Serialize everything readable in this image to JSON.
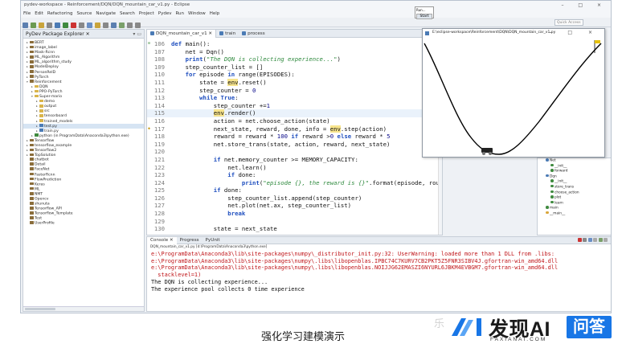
{
  "window": {
    "title": "pydev-workspace - Reinforcement/DQN/DQN_mountain_car_v1.py - Eclipse",
    "controls": "– □ ×",
    "menu": [
      "File",
      "Edit",
      "Refactoring",
      "Source",
      "Navigate",
      "Search",
      "Project",
      "Pydev",
      "Run",
      "Window",
      "Help"
    ],
    "quick_access_placeholder": "Quick Access"
  },
  "start_popup": {
    "label": "Run...",
    "button": "Start"
  },
  "explorer": {
    "title": "PyDev Package Explorer ✕",
    "items": [
      {
        "label": "BERT",
        "indent": 0,
        "arrow": ">",
        "icon": "#8a6d3b"
      },
      {
        "label": "image_label",
        "indent": 0,
        "arrow": ">",
        "icon": "#8a6d3b"
      },
      {
        "label": "Mask-Rcnn",
        "indent": 0,
        "arrow": ">",
        "icon": "#8a6d3b"
      },
      {
        "label": "ML_Algorithm",
        "indent": 0,
        "arrow": ">",
        "icon": "#8a6d3b"
      },
      {
        "label": "ML_algorithm_study",
        "indent": 0,
        "arrow": ">",
        "icon": "#8a6d3b"
      },
      {
        "label": "ModelDeploy",
        "indent": 0,
        "arrow": ">",
        "icon": "#8a6d3b"
      },
      {
        "label": "PersonReID",
        "indent": 0,
        "arrow": ">",
        "icon": "#8a6d3b"
      },
      {
        "label": "PyTorch",
        "indent": 0,
        "arrow": ">",
        "icon": "#8a6d3b"
      },
      {
        "label": "Reinforcement",
        "indent": 0,
        "arrow": "v",
        "icon": "#8a6d3b"
      },
      {
        "label": "DQN",
        "indent": 1,
        "arrow": ">",
        "icon": "#d9b44a"
      },
      {
        "label": "PPO-PyTorch",
        "indent": 1,
        "arrow": ">",
        "icon": "#d9b44a"
      },
      {
        "label": "Super-mario",
        "indent": 1,
        "arrow": "v",
        "icon": "#d9b44a"
      },
      {
        "label": "demo",
        "indent": 2,
        "arrow": ">",
        "icon": "#d9b44a"
      },
      {
        "label": "output",
        "indent": 2,
        "arrow": ">",
        "icon": "#d9b44a"
      },
      {
        "label": "src",
        "indent": 2,
        "arrow": ">",
        "icon": "#d9b44a"
      },
      {
        "label": "tensorboard",
        "indent": 2,
        "arrow": ">",
        "icon": "#d9b44a"
      },
      {
        "label": "trained_models",
        "indent": 2,
        "arrow": ">",
        "icon": "#d9b44a"
      },
      {
        "label": "test.py",
        "indent": 2,
        "arrow": ">",
        "icon": "#4b7bb5",
        "selected": true
      },
      {
        "label": "train.py",
        "indent": 2,
        "arrow": ">",
        "icon": "#4b7bb5"
      },
      {
        "label": "python (in ProgramData\\Anaconda3\\python.exe)",
        "indent": 1,
        "arrow": ">",
        "icon": "#3f8a3f"
      },
      {
        "label": "Tensorflow",
        "indent": 0,
        "arrow": ">",
        "icon": "#8a6d3b"
      },
      {
        "label": "tensorflow_example",
        "indent": 0,
        "arrow": ">",
        "icon": "#8a6d3b"
      },
      {
        "label": "Tensorflow2",
        "indent": 0,
        "arrow": ">",
        "icon": "#8a6d3b"
      },
      {
        "label": "TopSolution",
        "indent": 0,
        "arrow": ">",
        "icon": "#8a6d3b"
      },
      {
        "label": "chatbot",
        "indent": 0,
        "arrow": "",
        "icon": "#8a6d3b"
      },
      {
        "label": "Detail",
        "indent": 0,
        "arrow": "",
        "icon": "#8a6d3b"
      },
      {
        "label": "FaceNet",
        "indent": 0,
        "arrow": "",
        "icon": "#8a6d3b"
      },
      {
        "label": "FasterRcnn",
        "indent": 0,
        "arrow": "",
        "icon": "#8a6d3b"
      },
      {
        "label": "FlowPrediction",
        "indent": 0,
        "arrow": "",
        "icon": "#8a6d3b"
      },
      {
        "label": "Keras",
        "indent": 0,
        "arrow": "",
        "icon": "#8a6d3b"
      },
      {
        "label": "ML",
        "indent": 0,
        "arrow": "",
        "icon": "#8a6d3b"
      },
      {
        "label": "NMT",
        "indent": 0,
        "arrow": "",
        "icon": "#8a6d3b"
      },
      {
        "label": "Opencv",
        "indent": 0,
        "arrow": "",
        "icon": "#8a6d3b"
      },
      {
        "label": "shunuta",
        "indent": 0,
        "arrow": "",
        "icon": "#8a6d3b"
      },
      {
        "label": "Tensorflow_API",
        "indent": 0,
        "arrow": "",
        "icon": "#8a6d3b"
      },
      {
        "label": "Tensorflow_Template",
        "indent": 0,
        "arrow": "",
        "icon": "#8a6d3b"
      },
      {
        "label": "Test",
        "indent": 0,
        "arrow": "",
        "icon": "#8a6d3b"
      },
      {
        "label": "UserProfile",
        "indent": 0,
        "arrow": "",
        "icon": "#8a6d3b"
      }
    ]
  },
  "editor": {
    "tabs": [
      {
        "label": "DQN_mountain_car_v1 ✕",
        "active": true
      },
      {
        "label": "train",
        "active": false
      },
      {
        "label": "process",
        "active": false
      }
    ],
    "lines": [
      {
        "n": "106",
        "marker": "⊖",
        "html": "<span class='kw'>def</span> main():"
      },
      {
        "n": "107",
        "marker": "",
        "html": "    net = Dqn()"
      },
      {
        "n": "108",
        "marker": "",
        "html": "    <span class='kw'>print</span>(<span class='str'>\"The DQN is collecting experience...\"</span>)"
      },
      {
        "n": "109",
        "marker": "",
        "html": "    step_counter_list = []"
      },
      {
        "n": "110",
        "marker": "",
        "html": "    <span class='kw'>for</span> episode <span class='kw'>in</span> range(EPISODES):"
      },
      {
        "n": "111",
        "marker": "",
        "html": "        state = <span class='var'>env</span>.reset()"
      },
      {
        "n": "112",
        "marker": "",
        "html": "        step_counter = <span class='num'>0</span>"
      },
      {
        "n": "113",
        "marker": "",
        "html": "        <span class='kw'>while</span> <span class='kw'>True</span>:"
      },
      {
        "n": "114",
        "marker": "",
        "html": "            step_counter +=<span class='num'>1</span>"
      },
      {
        "n": "115",
        "marker": "",
        "html": "            <span class='var'>env</span>.render()",
        "hl": true
      },
      {
        "n": "116",
        "marker": "",
        "html": "            action = net.choose_action(state)"
      },
      {
        "n": "117",
        "marker": "◆",
        "html": "            next_state, reward, done, info = <span class='var'>env</span>.step(action)"
      },
      {
        "n": "118",
        "marker": "",
        "html": "            reward = reward * <span class='num'>100</span> <span class='kw'>if</span> reward &gt;<span class='num'>0</span> <span class='kw'>else</span> reward * <span class='num'>5</span>"
      },
      {
        "n": "119",
        "marker": "",
        "html": "            net.store_trans(state, action, reward, next_state)"
      },
      {
        "n": "120",
        "marker": "",
        "html": ""
      },
      {
        "n": "121",
        "marker": "",
        "html": "            <span class='kw'>if</span> net.memory_counter &gt;= MEMORY_CAPACITY:"
      },
      {
        "n": "122",
        "marker": "",
        "html": "                net.learn()"
      },
      {
        "n": "123",
        "marker": "",
        "html": "                <span class='kw'>if</span> done:"
      },
      {
        "n": "124",
        "marker": "",
        "html": "                    <span class='kw'>print</span>(<span class='str'>\"episode {}, the reward is {}\"</span>.format(episode, round(reward, <span class='num'>3</span>)))"
      },
      {
        "n": "125",
        "marker": "",
        "html": "            <span class='kw'>if</span> done:"
      },
      {
        "n": "126",
        "marker": "",
        "html": "                step_counter_list.append(step_counter)"
      },
      {
        "n": "127",
        "marker": "",
        "html": "                net.plot(net.ax, step_counter_list)"
      },
      {
        "n": "128",
        "marker": "",
        "html": "                <span class='kw'>break</span>"
      },
      {
        "n": "129",
        "marker": "",
        "html": ""
      },
      {
        "n": "130",
        "marker": "",
        "html": "            state = next_state"
      },
      {
        "n": "131",
        "marker": "",
        "html": ""
      }
    ]
  },
  "gym_window": {
    "title": "E:\\eclipse-workspace\\Reinforcement\\DQN\\DQN_mountain_car_v1.py",
    "controls": "– □ ×"
  },
  "outline": {
    "items": [
      {
        "label": "Net",
        "color": "#4b7bb5",
        "indent": 0
      },
      {
        "label": "__init__",
        "color": "#3f8a3f",
        "indent": 1
      },
      {
        "label": "forward",
        "color": "#3f8a3f",
        "indent": 1
      },
      {
        "label": "Dqn",
        "color": "#4b7bb5",
        "indent": 0
      },
      {
        "label": "__init__",
        "color": "#3f8a3f",
        "indent": 1
      },
      {
        "label": "store_trans",
        "color": "#3f8a3f",
        "indent": 1
      },
      {
        "label": "choose_action",
        "color": "#3f8a3f",
        "indent": 1
      },
      {
        "label": "plot",
        "color": "#3f8a3f",
        "indent": 1
      },
      {
        "label": "learn",
        "color": "#3f8a3f",
        "indent": 1
      },
      {
        "label": "main",
        "color": "#3f8a3f",
        "indent": 0
      },
      {
        "label": "__main__",
        "color": "#d9a53a",
        "indent": 0
      }
    ]
  },
  "console": {
    "tabs": [
      "Console ✕",
      "Progress",
      "PyUnit"
    ],
    "path": "DQN_mountain_car_v1.py [d:\\ProgramData\\Anaconda3\\python.exe]",
    "lines": [
      {
        "text": "e:\\ProgramData\\Anaconda3\\lib\\site-packages\\numpy\\_distributor_init.py:32: UserWarning: loaded more than 1 DLL from .libs:",
        "type": "err"
      },
      {
        "text": "e:\\ProgramData\\Anaconda3\\lib\\site-packages\\numpy\\.libs\\libopenblas.IPBC74C7KURV7CB2PKT5Z5FNR3SIBV4J.gfortran-win_amd64.dll",
        "type": "err"
      },
      {
        "text": "e:\\ProgramData\\Anaconda3\\lib\\site-packages\\numpy\\.libs\\libopenblas.NOIJJG62EMASZI6NYURL6JBKM4EVBGM7.gfortran-win_amd64.dll",
        "type": "err"
      },
      {
        "text": "  stacklevel=1)",
        "type": "err"
      },
      {
        "text": "The DQN is collecting experience...",
        "type": "out"
      },
      {
        "text": "The experience pool collects 0 time experience",
        "type": "out"
      }
    ]
  },
  "caption": "强化学习建模演示",
  "watermark": {
    "ghost": "乐",
    "brand": "发现AI",
    "brand_sub": "FAXIANAI.COM",
    "badge": "问答"
  }
}
